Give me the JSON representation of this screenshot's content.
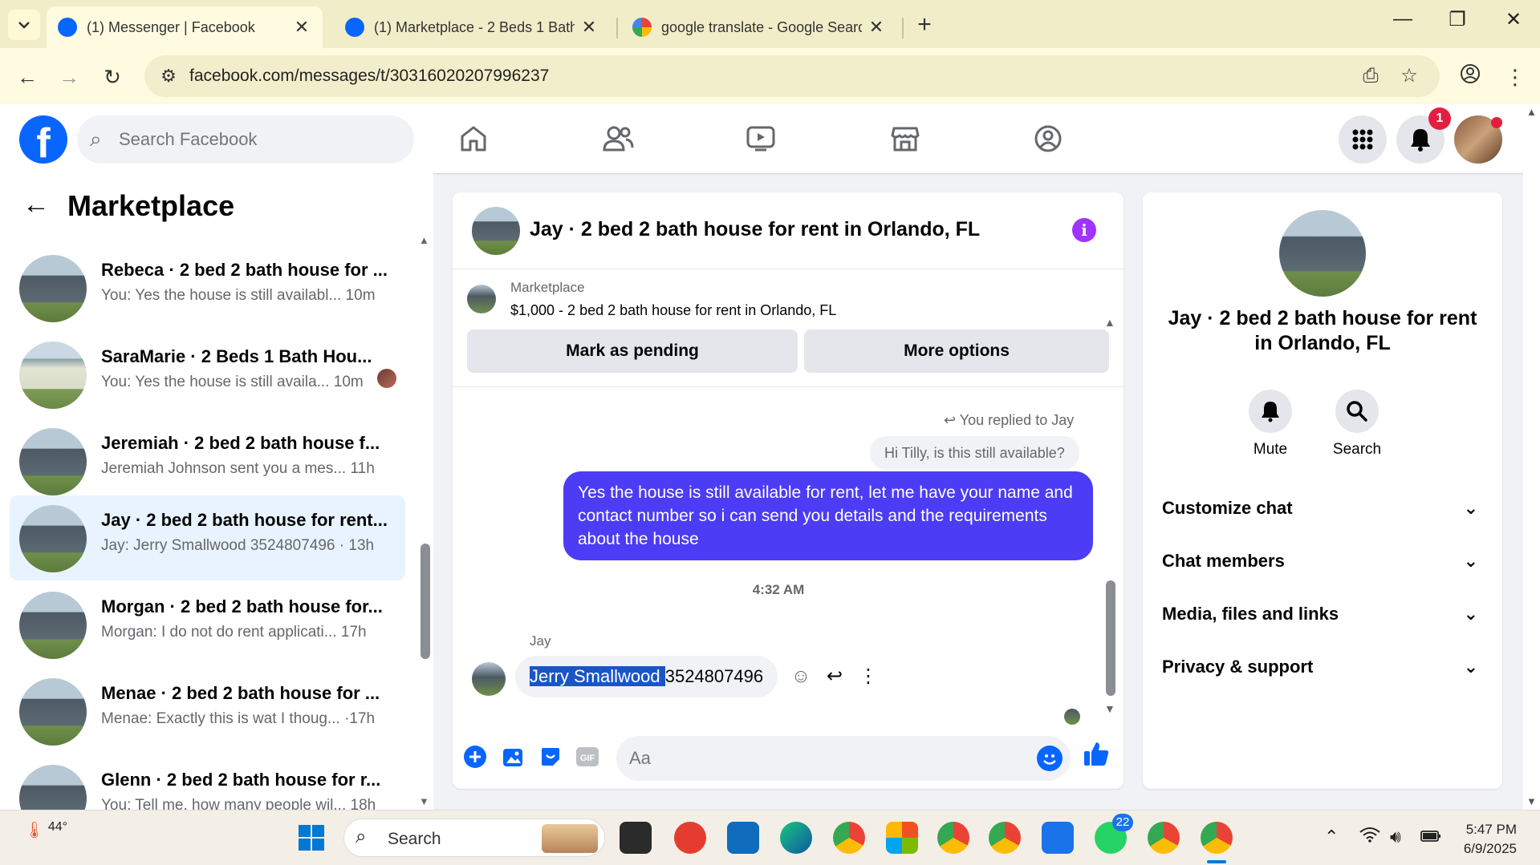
{
  "browser": {
    "tabs": [
      {
        "title": "(1) Messenger | Facebook",
        "active": true
      },
      {
        "title": "(1) Marketplace - 2 Beds 1 Bath",
        "active": false
      },
      {
        "title": "google translate - Google Search",
        "active": false
      }
    ],
    "url": "facebook.com/messages/t/30316020207996237"
  },
  "fb": {
    "search_placeholder": "Search Facebook",
    "notification_count": "1"
  },
  "left": {
    "title": "Marketplace",
    "chats": [
      {
        "name": "Rebeca · 2 bed 2 bath house for ...",
        "snippet": "You: Yes the house is still availabl...  10m"
      },
      {
        "name": "SaraMarie · 2 Beds 1 Bath Hou...",
        "snippet": "You: Yes the house is still availa...  10m"
      },
      {
        "name": "Jeremiah · 2 bed 2 bath house f...",
        "snippet": "Jeremiah Johnson sent you a mes...  11h"
      },
      {
        "name": "Jay · 2 bed 2 bath house for rent...",
        "snippet": "Jay: Jerry Smallwood 3524807496 · 13h"
      },
      {
        "name": "Morgan · 2 bed 2 bath house for...",
        "snippet": "Morgan: I do not do rent applicati...  17h"
      },
      {
        "name": "Menae · 2 bed 2 bath house for ...",
        "snippet": "Menae: Exactly this is wat I thoug...  ·17h"
      },
      {
        "name": "Glenn · 2 bed 2 bath house for r...",
        "snippet": "You: Tell me, how many people wil...  18h"
      }
    ]
  },
  "conversation": {
    "title": "Jay · 2 bed 2 bath house for rent in Orlando, FL",
    "marketplace_label": "Marketplace",
    "listing": "$1,000 - 2 bed 2 bath house for rent in Orlando, FL",
    "mark_pending": "Mark as pending",
    "more_options": "More options",
    "replied_to": "You replied to Jay",
    "quoted": "Hi Tilly, is this still available?",
    "my_message": "Yes the house is still available for rent, let me have your name and  contact number so i can send you details and the requirements about the house",
    "timestamp": "4:32 AM",
    "sender": "Jay",
    "their_selected": "Jerry Smallwood ",
    "their_rest": "3524807496",
    "composer_placeholder": "Aa"
  },
  "info": {
    "name": "Jay · 2 bed 2 bath house for rent in Orlando, FL",
    "mute": "Mute",
    "search": "Search",
    "rows": [
      "Customize chat",
      "Chat members",
      "Media, files and links",
      "Privacy & support"
    ]
  },
  "taskbar": {
    "temperature": "44°",
    "search": "Search",
    "whatsapp_badge": "22",
    "time": "5:47 PM",
    "date": "6/9/2025"
  },
  "colors": {
    "accent": "#0866ff",
    "my_bubble": "#4c3cf5",
    "selection": "#1a55c8",
    "info": "#a033ff",
    "badge": "#e41e3f"
  }
}
